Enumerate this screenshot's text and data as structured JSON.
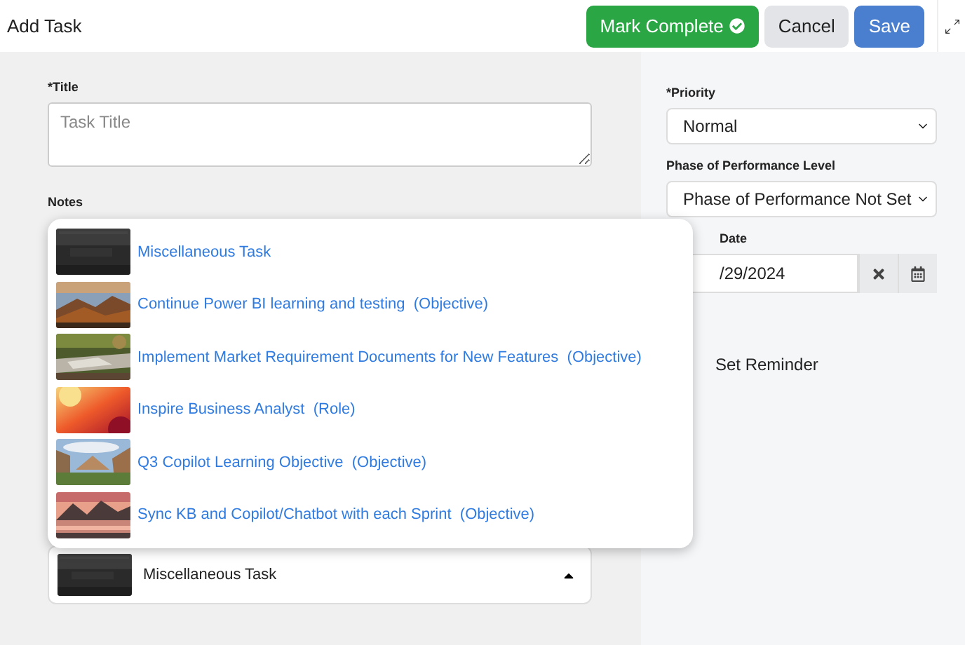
{
  "header": {
    "title": "Add Task",
    "buttons": [
      {
        "label": "Mark Complete",
        "kind": "complete"
      },
      {
        "label": "Cancel",
        "kind": "cancel"
      },
      {
        "label": "Save",
        "kind": "save"
      }
    ]
  },
  "title_field": {
    "label": "*Title",
    "placeholder": "Task Title"
  },
  "notes": {
    "label": "Notes"
  },
  "task_select": {
    "value": "Miscellaneous Task",
    "expanded": true,
    "options": [
      {
        "label": "Miscellaneous Task"
      },
      {
        "label": "Continue Power BI learning and testing  (Objective)"
      },
      {
        "label": "Implement Market Requirement Documents for New Features  (Objective)"
      },
      {
        "label": "Inspire Business Analyst  (Role)"
      },
      {
        "label": "Q3 Copilot Learning Objective  (Objective)"
      },
      {
        "label": "Sync KB and Copilot/Chatbot with each Sprint  (Objective)"
      }
    ]
  },
  "priority": {
    "label": "*Priority",
    "value": "Normal"
  },
  "phase": {
    "label": "Phase of Performance Level",
    "value": "Phase of Performance Not Set"
  },
  "due_date": {
    "label": "Date",
    "value": "/29/2024"
  },
  "reminder": {
    "label": "Set Reminder"
  }
}
